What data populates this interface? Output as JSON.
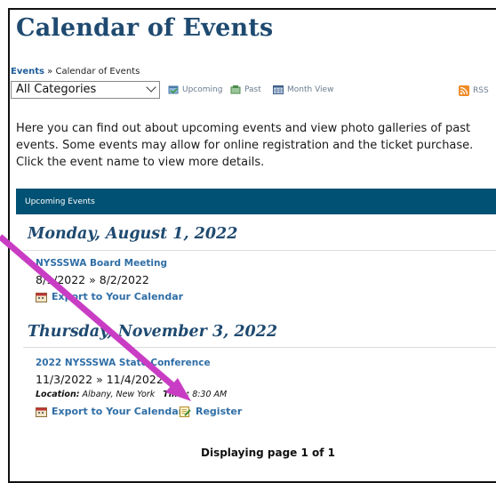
{
  "page": {
    "title": "Calendar of Events",
    "intro": "Here you can find out about upcoming events and view photo galleries of past events. Some events may allow for online registration and the ticket purchase. Click the event name to view more details."
  },
  "breadcrumb": {
    "link": "Events",
    "sep": " » ",
    "current": "Calendar of Events"
  },
  "category_select": {
    "value": "All Categories"
  },
  "toolbar": {
    "upcoming": "Upcoming",
    "past": "Past",
    "month_view": "Month View",
    "rss": "RSS"
  },
  "section_bar": {
    "label": "Upcoming Events"
  },
  "events": [
    {
      "date_heading": "Monday, August 1, 2022",
      "title": "NYSSSWA Board Meeting",
      "range": "8/1/2022 » 8/2/2022",
      "export": "Export to Your Calendar"
    },
    {
      "date_heading": "Thursday, November 3, 2022",
      "title": "2022 NYSSSWA State Conference",
      "range": "11/3/2022 » 11/4/2022",
      "location_label": "Location:",
      "location": "Albany, New York",
      "time_label": "Time:",
      "time": "8:30 AM",
      "export": "Export to Your Calendar",
      "register": "Register"
    }
  ],
  "paging": {
    "text": "Displaying page 1 of 1"
  },
  "colors": {
    "heading": "#1f4a70",
    "link": "#2f6ea6",
    "bar": "#005173",
    "arrow": "#c93dc4"
  }
}
